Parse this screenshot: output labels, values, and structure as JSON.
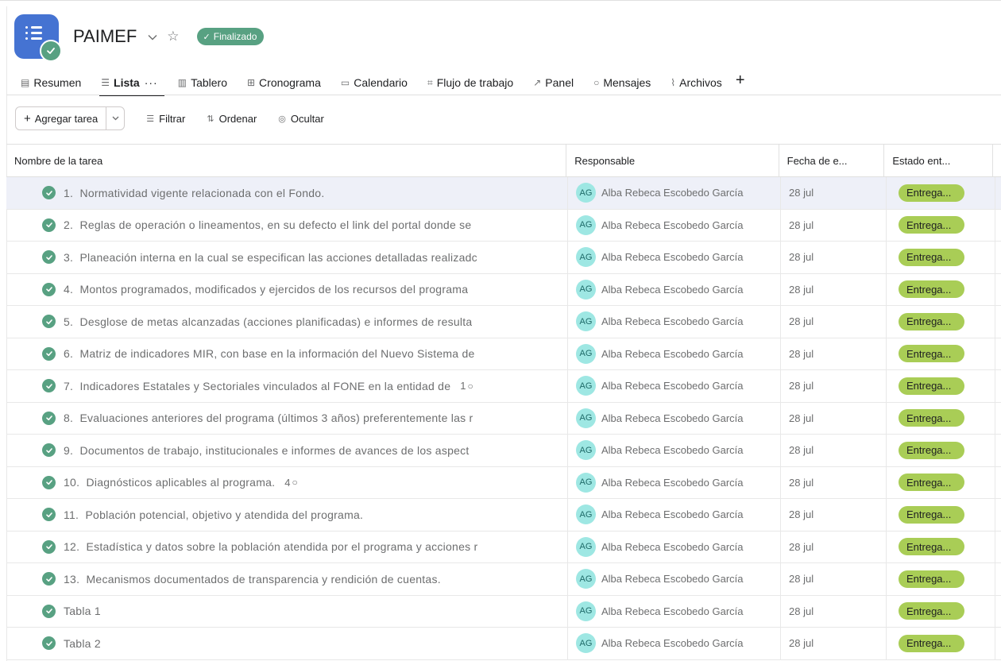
{
  "project": {
    "title": "PAIMEF",
    "status": "Finalizado",
    "colors": {
      "icon_bg": "#4573d2",
      "status_bg": "#58a182"
    }
  },
  "tabs": [
    {
      "label": "Resumen",
      "icon": "overview-icon"
    },
    {
      "label": "Lista",
      "icon": "list-icon",
      "active": true,
      "more": "···"
    },
    {
      "label": "Tablero",
      "icon": "board-icon"
    },
    {
      "label": "Cronograma",
      "icon": "timeline-icon"
    },
    {
      "label": "Calendario",
      "icon": "calendar-icon"
    },
    {
      "label": "Flujo de trabajo",
      "icon": "workflow-icon"
    },
    {
      "label": "Panel",
      "icon": "dashboard-icon"
    },
    {
      "label": "Mensajes",
      "icon": "message-icon"
    },
    {
      "label": "Archivos",
      "icon": "attachment-icon"
    }
  ],
  "toolbar": {
    "add_task": "Agregar tarea",
    "filter": "Filtrar",
    "sort": "Ordenar",
    "hide": "Ocultar"
  },
  "columns": {
    "name": "Nombre de la tarea",
    "assignee": "Responsable",
    "due": "Fecha de e...",
    "status": "Estado ent..."
  },
  "rows": [
    {
      "num": "1.",
      "name": "Normatividad vigente relacionada con el Fondo.",
      "comments": "",
      "assignee_initials": "AG",
      "assignee": "Alba Rebeca Escobedo García",
      "due": "28 jul",
      "status": "Entrega...",
      "selected": true
    },
    {
      "num": "2.",
      "name": "Reglas de operación o lineamentos, en su defecto el link del portal donde se",
      "comments": "",
      "assignee_initials": "AG",
      "assignee": "Alba Rebeca Escobedo García",
      "due": "28 jul",
      "status": "Entrega..."
    },
    {
      "num": "3.",
      "name": "Planeación interna en la cual se especifican las acciones detalladas realizadc",
      "comments": "",
      "assignee_initials": "AG",
      "assignee": "Alba Rebeca Escobedo García",
      "due": "28 jul",
      "status": "Entrega..."
    },
    {
      "num": "4.",
      "name": "Montos programados, modificados y ejercidos de los recursos del programa",
      "comments": "",
      "assignee_initials": "AG",
      "assignee": "Alba Rebeca Escobedo García",
      "due": "28 jul",
      "status": "Entrega..."
    },
    {
      "num": "5.",
      "name": "Desglose de metas alcanzadas (acciones planificadas) e informes de resulta",
      "comments": "",
      "assignee_initials": "AG",
      "assignee": "Alba Rebeca Escobedo García",
      "due": "28 jul",
      "status": "Entrega..."
    },
    {
      "num": "6.",
      "name": "Matriz de indicadores MIR, con base en la información del Nuevo Sistema de",
      "comments": "",
      "assignee_initials": "AG",
      "assignee": "Alba Rebeca Escobedo García",
      "due": "28 jul",
      "status": "Entrega..."
    },
    {
      "num": "7.",
      "name": "Indicadores Estatales y Sectoriales vinculados al FONE en la entidad de",
      "comments": "1",
      "assignee_initials": "AG",
      "assignee": "Alba Rebeca Escobedo García",
      "due": "28 jul",
      "status": "Entrega..."
    },
    {
      "num": "8.",
      "name": "Evaluaciones anteriores del programa (últimos 3 años) preferentemente las r",
      "comments": "",
      "assignee_initials": "AG",
      "assignee": "Alba Rebeca Escobedo García",
      "due": "28 jul",
      "status": "Entrega..."
    },
    {
      "num": "9.",
      "name": "Documentos de trabajo, institucionales e informes de avances de los aspect",
      "comments": "",
      "assignee_initials": "AG",
      "assignee": "Alba Rebeca Escobedo García",
      "due": "28 jul",
      "status": "Entrega..."
    },
    {
      "num": "10.",
      "name": "Diagnósticos aplicables al programa.",
      "comments": "4",
      "assignee_initials": "AG",
      "assignee": "Alba Rebeca Escobedo García",
      "due": "28 jul",
      "status": "Entrega..."
    },
    {
      "num": "11.",
      "name": "Población potencial, objetivo y atendida del programa.",
      "comments": "",
      "assignee_initials": "AG",
      "assignee": "Alba Rebeca Escobedo García",
      "due": "28 jul",
      "status": "Entrega..."
    },
    {
      "num": "12.",
      "name": "Estadística y datos sobre la población atendida por el programa y acciones r",
      "comments": "",
      "assignee_initials": "AG",
      "assignee": "Alba Rebeca Escobedo García",
      "due": "28 jul",
      "status": "Entrega..."
    },
    {
      "num": "13.",
      "name": "Mecanismos documentados de transparencia y rendición de cuentas.",
      "comments": "",
      "assignee_initials": "AG",
      "assignee": "Alba Rebeca Escobedo García",
      "due": "28 jul",
      "status": "Entrega..."
    },
    {
      "num": "",
      "name": "Tabla 1",
      "comments": "",
      "assignee_initials": "AG",
      "assignee": "Alba Rebeca Escobedo García",
      "due": "28 jul",
      "status": "Entrega..."
    },
    {
      "num": "",
      "name": "Tabla 2",
      "comments": "",
      "assignee_initials": "AG",
      "assignee": "Alba Rebeca Escobedo García",
      "due": "28 jul",
      "status": "Entrega..."
    }
  ]
}
